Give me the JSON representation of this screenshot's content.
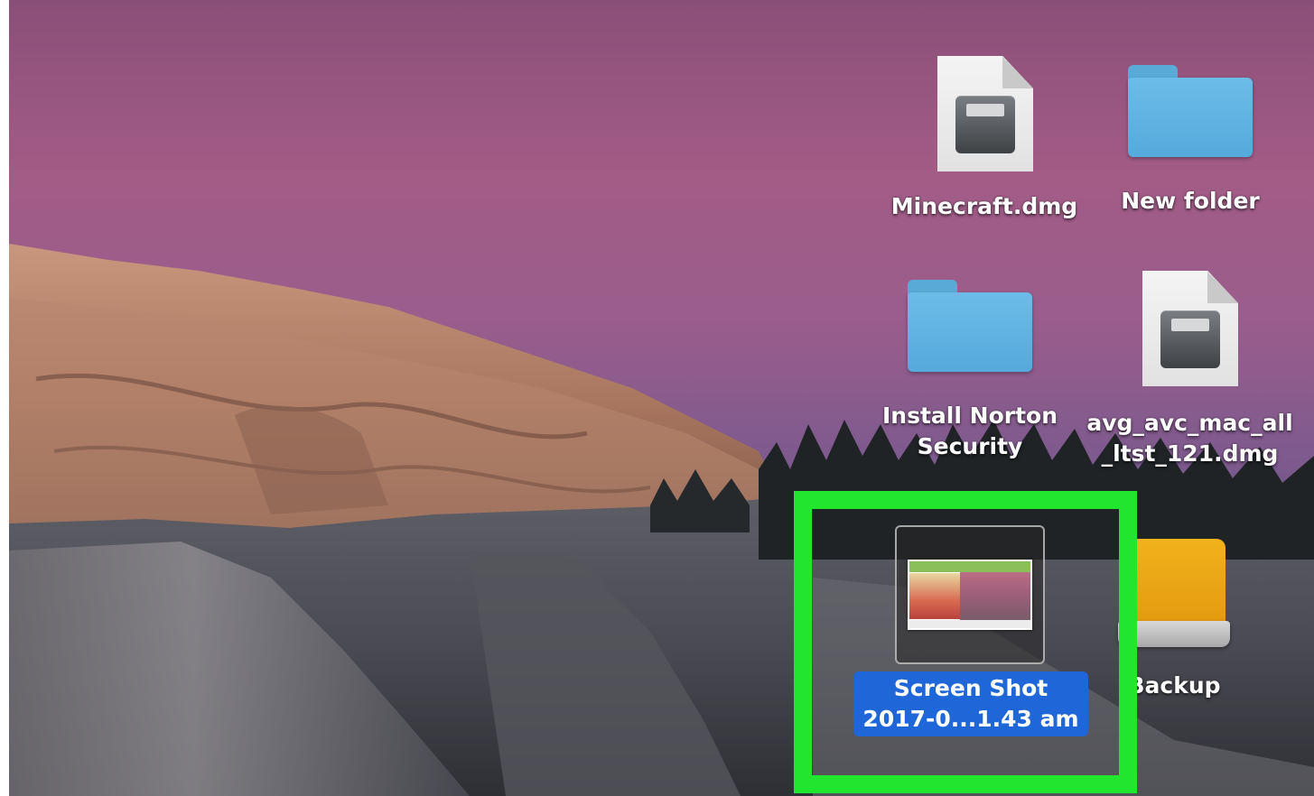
{
  "desktop": {
    "icons": [
      {
        "name": "Minecraft.dmg",
        "type": "disk-image",
        "icon": "disk-image-icon"
      },
      {
        "name": "New folder",
        "type": "folder",
        "icon": "folder-icon"
      },
      {
        "name": "Install Norton\nSecurity",
        "type": "folder",
        "icon": "folder-icon"
      },
      {
        "name": "avg_avc_mac_all\n_ltst_121.dmg",
        "type": "disk-image",
        "icon": "disk-image-icon"
      },
      {
        "name": "Screen Shot\n2017-0...1.43 am",
        "type": "screenshot",
        "icon": "screenshot-thumbnail-icon",
        "selected": true
      },
      {
        "name": "Backup",
        "type": "drive",
        "icon": "external-drive-icon"
      }
    ]
  },
  "colors": {
    "highlight": "#22e62e",
    "selection": "#1f67d9",
    "folder": "#6cbce8",
    "drive": "#f2b21c"
  }
}
